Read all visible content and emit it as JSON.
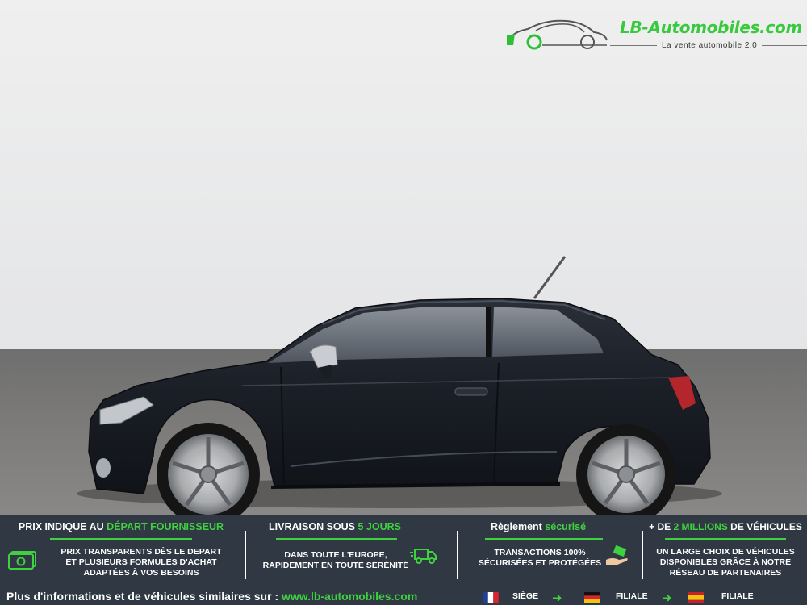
{
  "logo": {
    "name": "LB-Automobiles.com",
    "tagline": "La vente automobile 2.0"
  },
  "colors": {
    "accent_green": "#3fd13f",
    "banner_bg": "#2f3843",
    "car_body": "#1a1d24"
  },
  "features": [
    {
      "title_pre": "PRIX INDIQUE AU ",
      "title_hl": "DÉPART FOURNISSEUR",
      "title_post": "",
      "lines": [
        "PRIX TRANSPARENTS DÈS LE DEPART",
        "ET PLUSIEURS FORMULES D'ACHAT",
        "ADAPTÉES À VOS BESOINS"
      ],
      "icon": "banknote-icon"
    },
    {
      "title_pre": "LIVRAISON SOUS ",
      "title_hl": "5 JOURS",
      "title_post": "",
      "lines": [
        "DANS TOUTE L'EUROPE,",
        "RAPIDEMENT EN TOUTE SÉRÉNITÉ"
      ],
      "icon": "truck-icon"
    },
    {
      "title_pre": "Règlement ",
      "title_hl": "sécurisé",
      "title_post": "",
      "lines": [
        "TRANSACTIONS 100%",
        "SÉCURISÉES ET PROTÉGÉES"
      ],
      "icon": "payment-hand-icon"
    },
    {
      "title_pre": "+ DE ",
      "title_hl": "2 MILLIONS",
      "title_post": " DE VÉHICULES",
      "lines": [
        "UN LARGE CHOIX DE VÉHICULES",
        "DISPONIBLES GRÂCE À NOTRE",
        "RÉSEAU DE PARTENAIRES"
      ],
      "icon": ""
    }
  ],
  "footer": {
    "text": "Plus d'informations et de véhicules similaires sur : ",
    "link": "www.lb-automobiles.com",
    "locations": [
      {
        "flag": "france-flag",
        "label": "SIÈGE"
      },
      {
        "flag": "germany-flag",
        "label": "FILIALE"
      },
      {
        "flag": "spain-flag",
        "label": "FILIALE"
      }
    ]
  }
}
